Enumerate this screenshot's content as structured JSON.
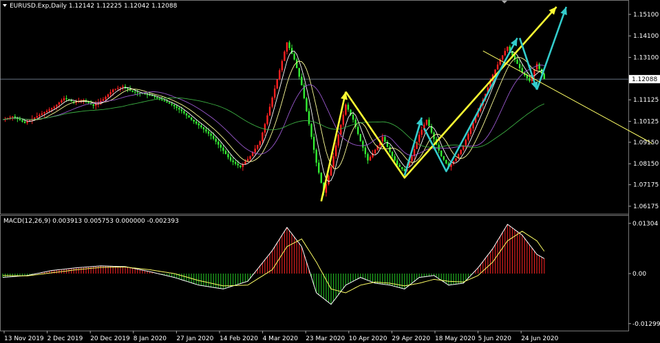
{
  "header": {
    "symbol_line": "EURUSD.Exp,Daily  1.12142 1.12225 1.12042 1.12088"
  },
  "price_axis": {
    "ticks": [
      "1.15100",
      "1.14100",
      "1.13100",
      "1.12088",
      "1.11125",
      "1.10125",
      "1.09150",
      "1.08150",
      "1.07175",
      "1.06175"
    ],
    "current_price": "1.12088"
  },
  "macd": {
    "label": "MACD(12,26,9) 0.003913 0.005753 0.000000 -0.002393",
    "ticks": [
      "0.01304",
      "0.00",
      "-0.012998"
    ]
  },
  "time_axis": [
    "13 Nov 2019",
    "2 Dec 2019",
    "20 Dec 2019",
    "8 Jan 2020",
    "27 Jan 2020",
    "14 Feb 2020",
    "4 Mar 2020",
    "23 Mar 2020",
    "10 Apr 2020",
    "29 Apr 2020",
    "18 May 2020",
    "5 Jun 2020",
    "24 Jun 2020"
  ],
  "chart_data": {
    "type": "candlestick",
    "symbol": "EURUSD.Exp",
    "timeframe": "Daily",
    "ohlc_last": {
      "open": 1.12142,
      "high": 1.12225,
      "low": 1.12042,
      "close": 1.12088
    },
    "price_range": [
      1.0595,
      1.1545
    ],
    "close_path": [
      [
        0,
        1.102
      ],
      [
        4,
        1.1035
      ],
      [
        9,
        1.1005
      ],
      [
        13,
        1.103
      ],
      [
        17,
        1.1055
      ],
      [
        21,
        1.108
      ],
      [
        25,
        1.112
      ],
      [
        29,
        1.11
      ],
      [
        33,
        1.111
      ],
      [
        37,
        1.1085
      ],
      [
        41,
        1.1115
      ],
      [
        45,
        1.116
      ],
      [
        49,
        1.1175
      ],
      [
        53,
        1.115
      ],
      [
        57,
        1.114
      ],
      [
        61,
        1.113
      ],
      [
        65,
        1.111
      ],
      [
        69,
        1.109
      ],
      [
        73,
        1.106
      ],
      [
        77,
        1.102
      ],
      [
        81,
        1.0985
      ],
      [
        85,
        1.0945
      ],
      [
        89,
        1.089
      ],
      [
        93,
        1.083
      ],
      [
        97,
        1.08
      ],
      [
        101,
        1.085
      ],
      [
        105,
        1.092
      ],
      [
        109,
        1.108
      ],
      [
        113,
        1.125
      ],
      [
        116,
        1.138
      ],
      [
        119,
        1.13
      ],
      [
        122,
        1.118
      ],
      [
        125,
        1.1
      ],
      [
        128,
        1.082
      ],
      [
        131,
        1.068
      ],
      [
        134,
        1.08
      ],
      [
        137,
        1.095
      ],
      [
        140,
        1.109
      ],
      [
        143,
        1.102
      ],
      [
        146,
        1.092
      ],
      [
        149,
        1.083
      ],
      [
        152,
        1.088
      ],
      [
        155,
        1.094
      ],
      [
        158,
        1.087
      ],
      [
        161,
        1.081
      ],
      [
        164,
        1.078
      ],
      [
        167,
        1.085
      ],
      [
        170,
        1.095
      ],
      [
        173,
        1.102
      ],
      [
        176,
        1.093
      ],
      [
        179,
        1.085
      ],
      [
        182,
        1.08
      ],
      [
        185,
        1.084
      ],
      [
        188,
        1.09
      ],
      [
        191,
        1.098
      ],
      [
        194,
        1.106
      ],
      [
        197,
        1.114
      ],
      [
        200,
        1.123
      ],
      [
        203,
        1.13
      ],
      [
        206,
        1.136
      ],
      [
        209,
        1.13
      ],
      [
        212,
        1.124
      ],
      [
        215,
        1.12
      ],
      [
        218,
        1.128
      ],
      [
        221,
        1.1209
      ]
    ],
    "moving_averages": [
      {
        "color": "#ffffff",
        "period": "fast"
      },
      {
        "color": "#ffff99",
        "period": "medium"
      },
      {
        "color": "#9b59d0",
        "period": "slow"
      },
      {
        "color": "#3cb043",
        "period": "long"
      }
    ],
    "macd_series": {
      "macd_line": [
        [
          0,
          -0.001
        ],
        [
          10,
          -0.0005
        ],
        [
          20,
          0.0008
        ],
        [
          30,
          0.0015
        ],
        [
          40,
          0.002
        ],
        [
          50,
          0.0018
        ],
        [
          60,
          0.0005
        ],
        [
          70,
          -0.001
        ],
        [
          80,
          -0.003
        ],
        [
          90,
          -0.004
        ],
        [
          100,
          -0.002
        ],
        [
          110,
          0.006
        ],
        [
          116,
          0.012
        ],
        [
          122,
          0.007
        ],
        [
          128,
          -0.005
        ],
        [
          134,
          -0.008
        ],
        [
          140,
          -0.003
        ],
        [
          146,
          -0.001
        ],
        [
          152,
          -0.0025
        ],
        [
          158,
          -0.003
        ],
        [
          164,
          -0.004
        ],
        [
          170,
          -0.001
        ],
        [
          176,
          -0.0005
        ],
        [
          182,
          -0.003
        ],
        [
          188,
          -0.0025
        ],
        [
          194,
          0.0015
        ],
        [
          200,
          0.0065
        ],
        [
          206,
          0.0128
        ],
        [
          212,
          0.01
        ],
        [
          218,
          0.005
        ],
        [
          221,
          0.0039
        ]
      ],
      "signal_line": [
        [
          0,
          -0.0005
        ],
        [
          10,
          -0.0006
        ],
        [
          20,
          0.0002
        ],
        [
          30,
          0.001
        ],
        [
          40,
          0.0016
        ],
        [
          50,
          0.0017
        ],
        [
          60,
          0.001
        ],
        [
          70,
          0.0
        ],
        [
          80,
          -0.0018
        ],
        [
          90,
          -0.0032
        ],
        [
          100,
          -0.003
        ],
        [
          110,
          0.001
        ],
        [
          116,
          0.007
        ],
        [
          122,
          0.009
        ],
        [
          128,
          0.003
        ],
        [
          134,
          -0.004
        ],
        [
          140,
          -0.005
        ],
        [
          146,
          -0.003
        ],
        [
          152,
          -0.0022
        ],
        [
          158,
          -0.0025
        ],
        [
          164,
          -0.0032
        ],
        [
          170,
          -0.0025
        ],
        [
          176,
          -0.0015
        ],
        [
          182,
          -0.002
        ],
        [
          188,
          -0.0022
        ],
        [
          194,
          -0.0005
        ],
        [
          200,
          0.003
        ],
        [
          206,
          0.0085
        ],
        [
          212,
          0.011
        ],
        [
          218,
          0.0085
        ],
        [
          221,
          0.0058
        ]
      ]
    },
    "annotations": [
      {
        "type": "arrow",
        "color": "#ffff33",
        "points": [
          [
            130,
            1.064
          ],
          [
            140,
            1.115
          ]
        ]
      },
      {
        "type": "arrow",
        "color": "#ffff33",
        "points": [
          [
            140,
            1.115
          ],
          [
            164,
            1.075
          ],
          [
            226,
            1.1545
          ]
        ]
      },
      {
        "type": "arrow",
        "color": "#33cccc",
        "points": [
          [
            164,
            1.076
          ],
          [
            171,
            1.103
          ]
        ]
      },
      {
        "type": "arrow",
        "color": "#33cccc",
        "points": [
          [
            172,
            1.098
          ],
          [
            181,
            1.078
          ],
          [
            210,
            1.14
          ]
        ]
      },
      {
        "type": "arrow",
        "color": "#33cccc",
        "points": [
          [
            211,
            1.14
          ],
          [
            218,
            1.116
          ]
        ]
      },
      {
        "type": "arrow",
        "color": "#33cccc",
        "points": [
          [
            218,
            1.116
          ],
          [
            230,
            1.1545
          ]
        ]
      },
      {
        "type": "trendline",
        "color": "#ffff66",
        "points": [
          [
            196,
            1.134
          ],
          [
            265,
            1.091
          ]
        ]
      }
    ]
  }
}
